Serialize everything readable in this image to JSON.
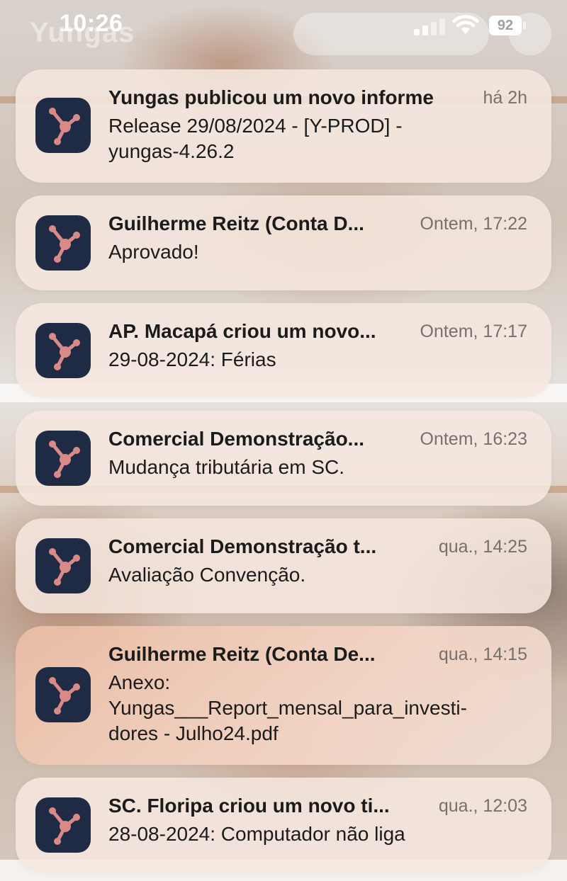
{
  "status_bar": {
    "time": "10:26",
    "battery": "92"
  },
  "background": {
    "ghost_text": "Yungas"
  },
  "notifications": [
    {
      "title": "Yungas publicou um novo informe",
      "time": "há 2h",
      "body": [
        "Release 29/08/2024 - [Y-PROD] -",
        "yungas-4.26.2"
      ]
    },
    {
      "title": "Guilherme Reitz (Conta D...",
      "time": "Ontem, 17:22",
      "body": [
        "Aprovado!"
      ]
    },
    {
      "title": "AP. Macapá criou um novo...",
      "time": "Ontem, 17:17",
      "body": [
        "29-08-2024: Férias"
      ]
    },
    {
      "title": "Comercial Demonstração...",
      "time": "Ontem, 16:23",
      "body": [
        "Mudança tributária em SC."
      ]
    },
    {
      "title": "Comercial Demonstração t...",
      "time": "qua., 14:25",
      "body": [
        "Avaliação Convenção."
      ]
    },
    {
      "title": "Guilherme Reitz (Conta De...",
      "time": "qua., 14:15",
      "body": [
        "Anexo:",
        "Yungas___Report_mensal_para_investi-",
        "dores - Julho24.pdf"
      ]
    },
    {
      "title": "SC. Floripa criou um novo ti...",
      "time": "qua., 12:03",
      "body": [
        "28-08-2024: Computador não liga"
      ]
    }
  ],
  "colors": {
    "app_icon_bg": "#1f2a44",
    "app_icon_mark": "#d98a86"
  }
}
